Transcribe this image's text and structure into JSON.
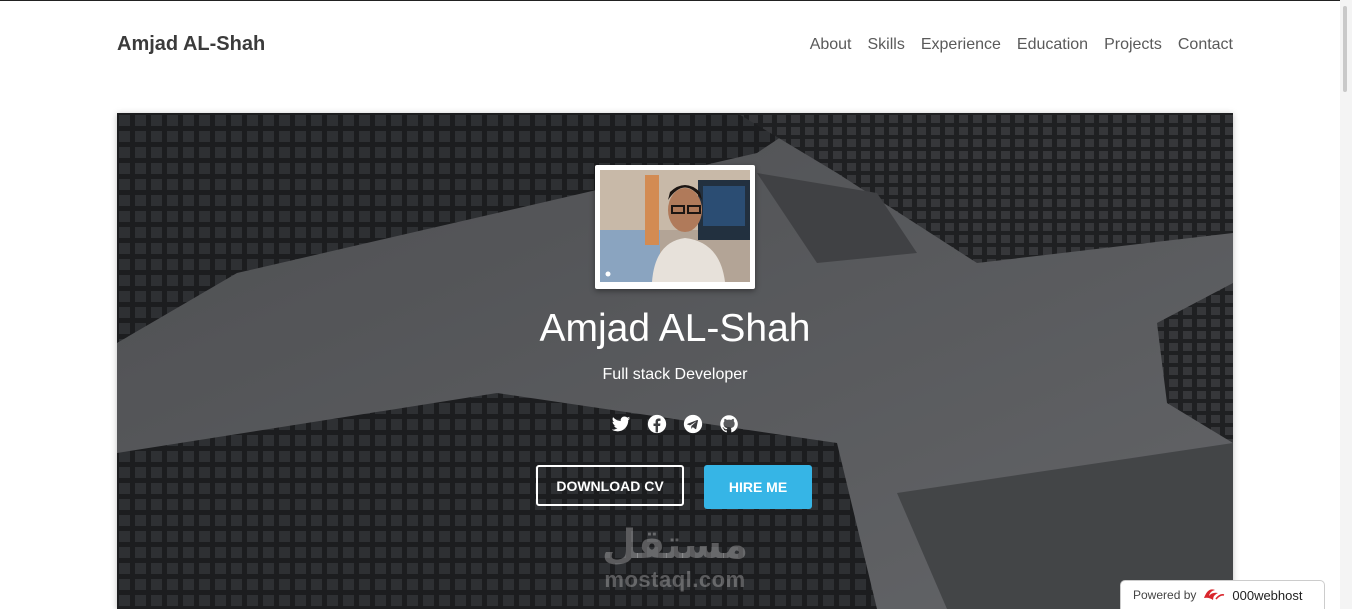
{
  "navbar": {
    "brand": "Amjad AL-Shah",
    "links": [
      {
        "label": "About"
      },
      {
        "label": "Skills"
      },
      {
        "label": "Experience"
      },
      {
        "label": "Education"
      },
      {
        "label": "Projects"
      },
      {
        "label": "Contact"
      }
    ]
  },
  "hero": {
    "name": "Amjad AL-Shah",
    "role": "Full stack Developer",
    "social_icons": [
      "twitter-icon",
      "facebook-icon",
      "telegram-icon",
      "github-icon"
    ],
    "download_label": "DOWNLOAD CV",
    "hire_label": "HIRE ME",
    "accent_color": "#36b5e6"
  },
  "watermark": {
    "arabic": "مستقل",
    "latin": "mostaql.com"
  },
  "footer_badge": {
    "prefix": "Powered by",
    "host": "000webhost",
    "logo_color": "#d9262c"
  }
}
